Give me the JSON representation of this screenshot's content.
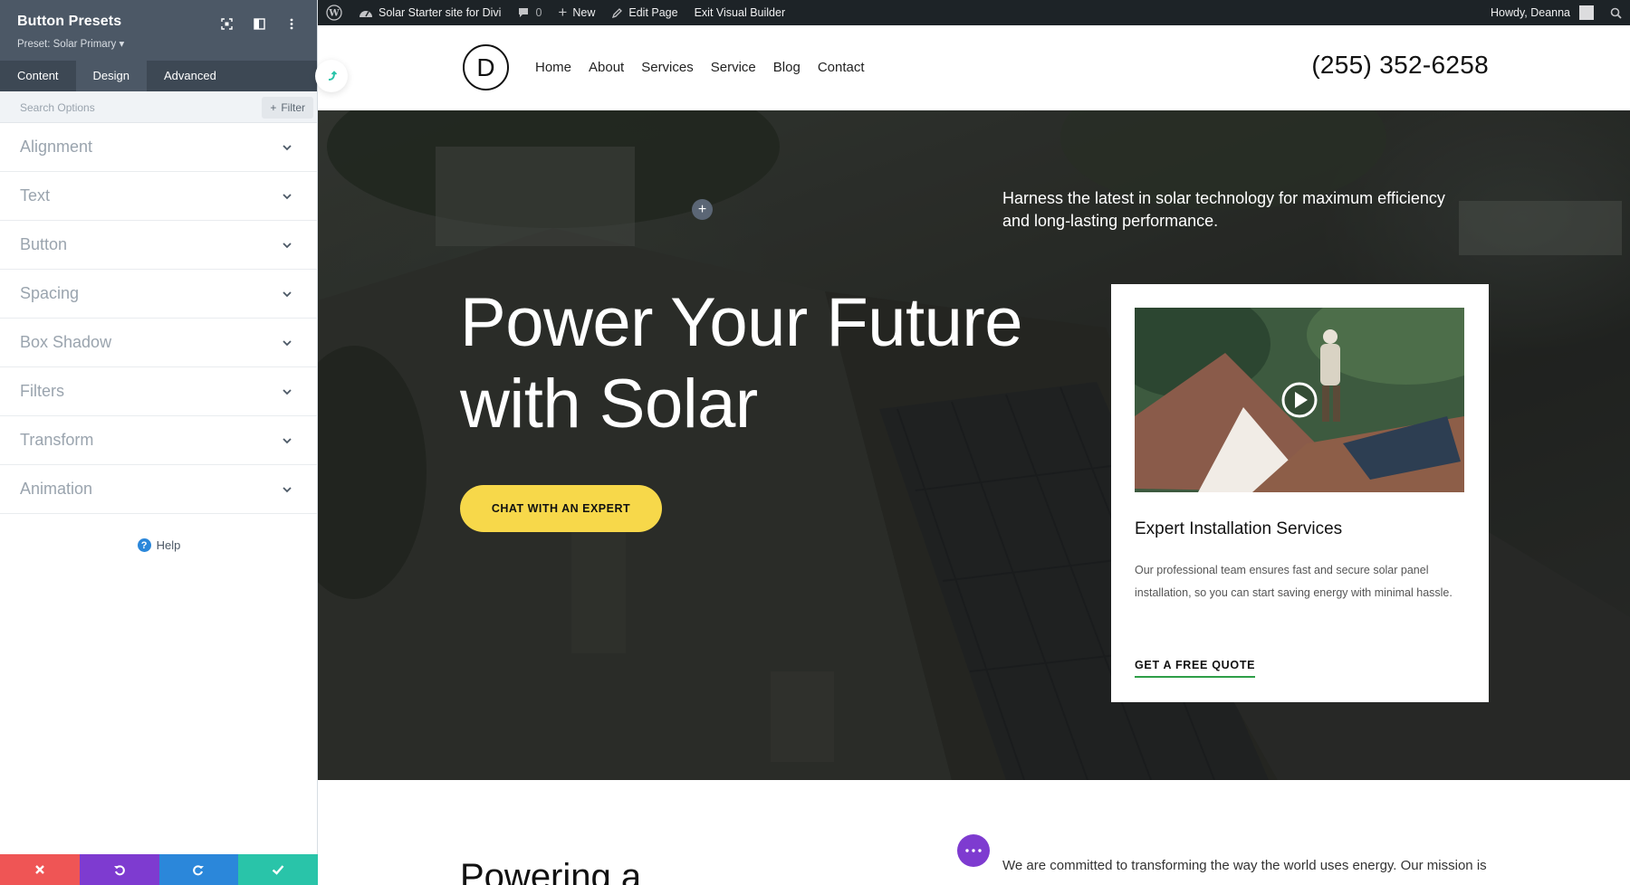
{
  "panel": {
    "title": "Button Presets",
    "subtitle": "Preset: Solar Primary ▾",
    "tabs": [
      {
        "label": "Content",
        "active": false
      },
      {
        "label": "Design",
        "active": true
      },
      {
        "label": "Advanced",
        "active": false
      }
    ],
    "search_placeholder": "Search Options",
    "filter_label": "Filter",
    "sections": [
      "Alignment",
      "Text",
      "Button",
      "Spacing",
      "Box Shadow",
      "Filters",
      "Transform",
      "Animation"
    ],
    "help_label": "Help",
    "footer_colors": {
      "discard": "#ef5555",
      "undo": "#7e3bd0",
      "redo": "#2b87da",
      "save": "#29c4a9"
    }
  },
  "adminbar": {
    "site_name": "Solar Starter site for Divi",
    "comments_count": "0",
    "new_label": "New",
    "edit_label": "Edit Page",
    "exit_label": "Exit Visual Builder",
    "greeting": "Howdy, Deanna"
  },
  "header": {
    "logo_letter": "D",
    "nav": [
      "Home",
      "About",
      "Services",
      "Service",
      "Blog",
      "Contact"
    ],
    "phone": "(255) 352-6258"
  },
  "hero": {
    "tagline": "Harness the latest in solar technology for maximum efficiency and long-lasting performance.",
    "title_line1": "Power Your Future",
    "title_line2": "with Solar",
    "cta": "CHAT WITH AN EXPERT",
    "cta_color": "#f7d84a"
  },
  "card": {
    "title": "Expert Installation Services",
    "body": "Our professional team ensures fast and secure solar panel installation, so you can start saving energy with minimal hassle.",
    "link": "GET A FREE QUOTE",
    "link_underline_color": "#2e9e48"
  },
  "below": {
    "heading": "Powering a",
    "text": "We are committed to transforming the way the world uses energy. Our mission is"
  }
}
